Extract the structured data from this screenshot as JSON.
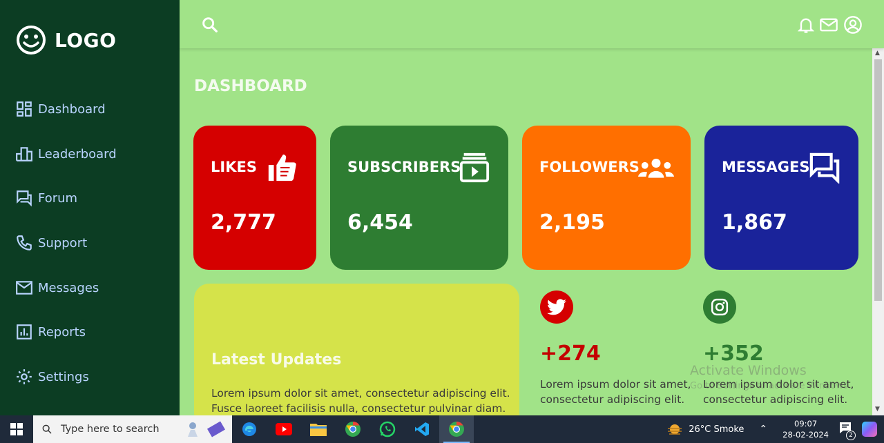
{
  "sidebar": {
    "logo_text": "LOGO",
    "items": [
      {
        "label": "Dashboard",
        "icon": "dashboard-icon"
      },
      {
        "label": "Leaderboard",
        "icon": "leaderboard-icon"
      },
      {
        "label": "Forum",
        "icon": "forum-icon"
      },
      {
        "label": "Support",
        "icon": "phone-icon"
      },
      {
        "label": "Messages",
        "icon": "mail-icon"
      },
      {
        "label": "Reports",
        "icon": "reports-icon"
      },
      {
        "label": "Settings",
        "icon": "gear-icon"
      }
    ]
  },
  "header": {
    "icons": [
      "search-icon",
      "bell-icon",
      "mail-icon",
      "account-icon"
    ]
  },
  "main": {
    "title": "DASHBOARD",
    "cards": [
      {
        "label": "LIKES",
        "value": "2,777",
        "color": "#d50000",
        "icon": "thumbs-up-icon"
      },
      {
        "label": "SUBSCRIBERS",
        "value": "6,454",
        "color": "#2e7d32",
        "icon": "subscriptions-icon"
      },
      {
        "label": "FOLLOWERS",
        "value": "2,195",
        "color": "#ff6f00",
        "icon": "group-icon"
      },
      {
        "label": "MESSAGES",
        "value": "1,867",
        "color": "#1a239a",
        "icon": "chat-icon"
      }
    ],
    "updates": {
      "title": "Latest Updates",
      "text": "Lorem ipsum dolor sit amet, consectetur adipiscing elit. Fusce laoreet facilisis nulla, consectetur pulvinar diam."
    },
    "social": [
      {
        "count": "+274",
        "text": "Lorem ipsum dolor sit amet, consectetur adipiscing elit.",
        "color": "#c40000",
        "icon": "twitter-icon"
      },
      {
        "count": "+352",
        "text": "Lorem ipsum dolor sit amet, consectetur adipiscing elit.",
        "color": "#2e7d32",
        "icon": "instagram-icon"
      }
    ]
  },
  "watermark": {
    "line1": "Activate Windows",
    "line2": "Go to Settings to activate Windows."
  },
  "taskbar": {
    "search_placeholder": "Type here to search",
    "weather": "26°C  Smoke",
    "time": "09:07",
    "date": "28-02-2024",
    "notification_count": "2"
  }
}
